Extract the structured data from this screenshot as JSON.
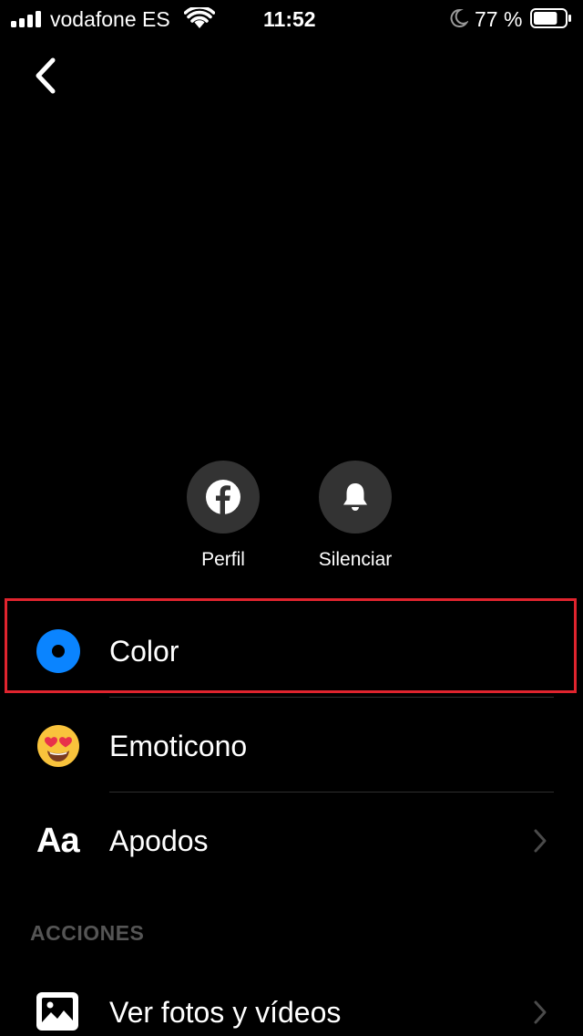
{
  "status_bar": {
    "carrier": "vodafone ES",
    "time": "11:52",
    "battery_percent": "77 %",
    "battery_level": 0.77,
    "icons": [
      "signal-icon",
      "wifi-icon",
      "moon-icon",
      "battery-icon"
    ]
  },
  "nav": {
    "back_icon": "chevron-left-icon"
  },
  "actions": [
    {
      "label": "Perfil",
      "icon": "facebook-icon"
    },
    {
      "label": "Silenciar",
      "icon": "bell-icon"
    }
  ],
  "settings": [
    {
      "label": "Color",
      "icon": "color-dot-icon",
      "highlighted": true
    },
    {
      "label": "Emoticono",
      "icon": "heart-eyes-emoji-icon"
    },
    {
      "label": "Apodos",
      "icon": "text-aa-icon",
      "icon_text": "Aa",
      "has_chevron": true
    }
  ],
  "sections": {
    "acciones": {
      "header": "ACCIONES",
      "items": [
        {
          "label": "Ver fotos y vídeos",
          "icon": "photo-icon",
          "has_chevron": true
        }
      ]
    }
  },
  "colors": {
    "background": "#000000",
    "accent_blue": "#0a84ff",
    "highlight_border": "#e0242e",
    "circle_button": "#333333",
    "section_header": "#555555",
    "chevron": "#4a4a4a"
  }
}
